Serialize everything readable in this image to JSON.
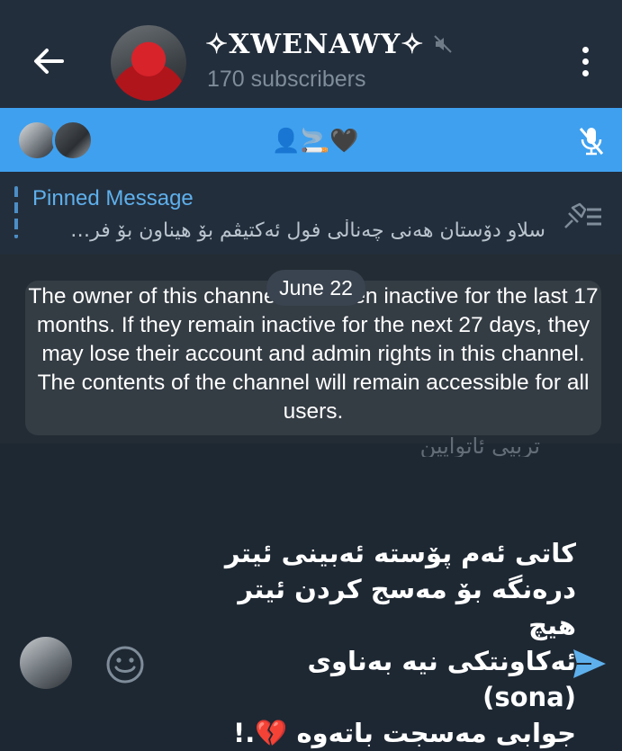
{
  "header": {
    "title": "✧XWENAWY✧",
    "subscribers": "170 subscribers",
    "icons": [
      "back-arrow-icon",
      "muted-speaker-icon",
      "more-vertical-icon"
    ]
  },
  "voice_chat": {
    "title_emoji": "👤🚬🖤",
    "icons": [
      "mic-off-icon"
    ]
  },
  "pinned": {
    "label": "Pinned Message",
    "preview": "سلاو دۆستان هەنی چەناڵی فول ئەکتیڤم بۆ هیناون بۆ فر…"
  },
  "chat": {
    "date": "June 22",
    "notice": "The owner of this channel has been inactive for the last 17 months. If they remain inactive for the next 27 days, they may lose their account and admin rights in this channel. The contents of the channel will remain accessible for all users.",
    "faded_text": "تربیی ئاتوایین",
    "message_lines": [
      "کاتی ئەم پۆستە ئەبینی ئیتر",
      "درەنگە بۆ مەسج کردن ئیتر هیچ",
      "ئەکاونتکی نیە بەناوی (sona)",
      "جوابی مەسجت باتەوە 💔.!"
    ]
  },
  "colors": {
    "header_bg": "#232e3c",
    "voice_bar": "#3fa0ef",
    "accent": "#5eb0ec",
    "chat_bg": "#1e2833"
  }
}
